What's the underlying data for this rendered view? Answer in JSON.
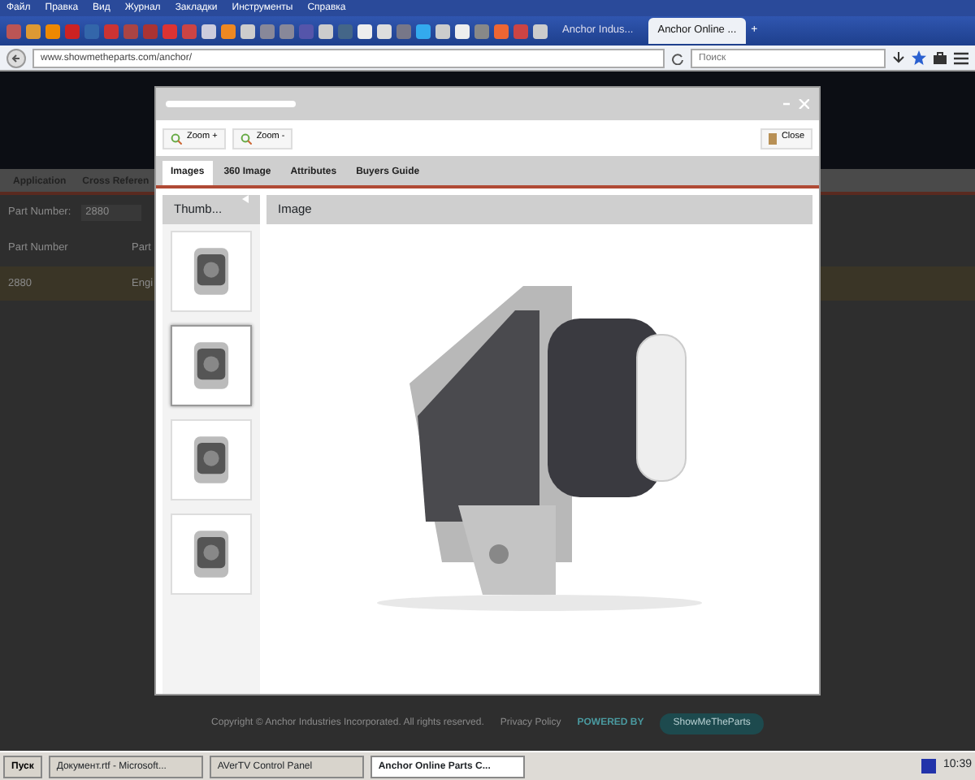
{
  "browser": {
    "menu": [
      "Файл",
      "Правка",
      "Вид",
      "Журнал",
      "Закладки",
      "Инструменты",
      "Справка"
    ],
    "tabs": [
      {
        "label": "Anchor Indus...",
        "selected": false
      },
      {
        "label": "Anchor Online ...",
        "selected": true
      }
    ],
    "new_tab": "+",
    "address": "www.showmetheparts.com/anchor/",
    "search": {
      "placeholder": "Поиск"
    }
  },
  "page": {
    "nav": [
      "Application",
      "Cross Referen"
    ],
    "part_label": "Part Number:",
    "part_value": "2880",
    "columns": [
      "Part Number",
      "Part"
    ],
    "rows": [
      [
        "2880",
        "Engi"
      ]
    ],
    "footer": {
      "copyright": "Copyright © Anchor Industries Incorporated. All rights reserved.",
      "privacy": "Privacy Policy",
      "powered": "POWERED BY",
      "brand": "ShowMeTheParts"
    }
  },
  "modal": {
    "toolbar": [
      "Zoom +",
      "Zoom -"
    ],
    "close": "Close",
    "tabs": [
      {
        "label": "Images",
        "selected": true
      },
      {
        "label": "360 Image",
        "selected": false
      },
      {
        "label": "Attributes",
        "selected": false
      },
      {
        "label": "Buyers Guide",
        "selected": false
      }
    ],
    "thumbs_header": "Thumb...",
    "image_header": "Image",
    "thumbnails": [
      {
        "selected": false
      },
      {
        "selected": true
      },
      {
        "selected": false
      },
      {
        "selected": false
      }
    ]
  },
  "taskbar": {
    "start": "Пуск",
    "items": [
      {
        "label": "Документ.rtf - Microsoft...",
        "selected": false
      },
      {
        "label": "AVerTV Control Panel",
        "selected": false
      },
      {
        "label": "Anchor Online Parts C...",
        "selected": true
      }
    ],
    "clock": "10:39"
  }
}
